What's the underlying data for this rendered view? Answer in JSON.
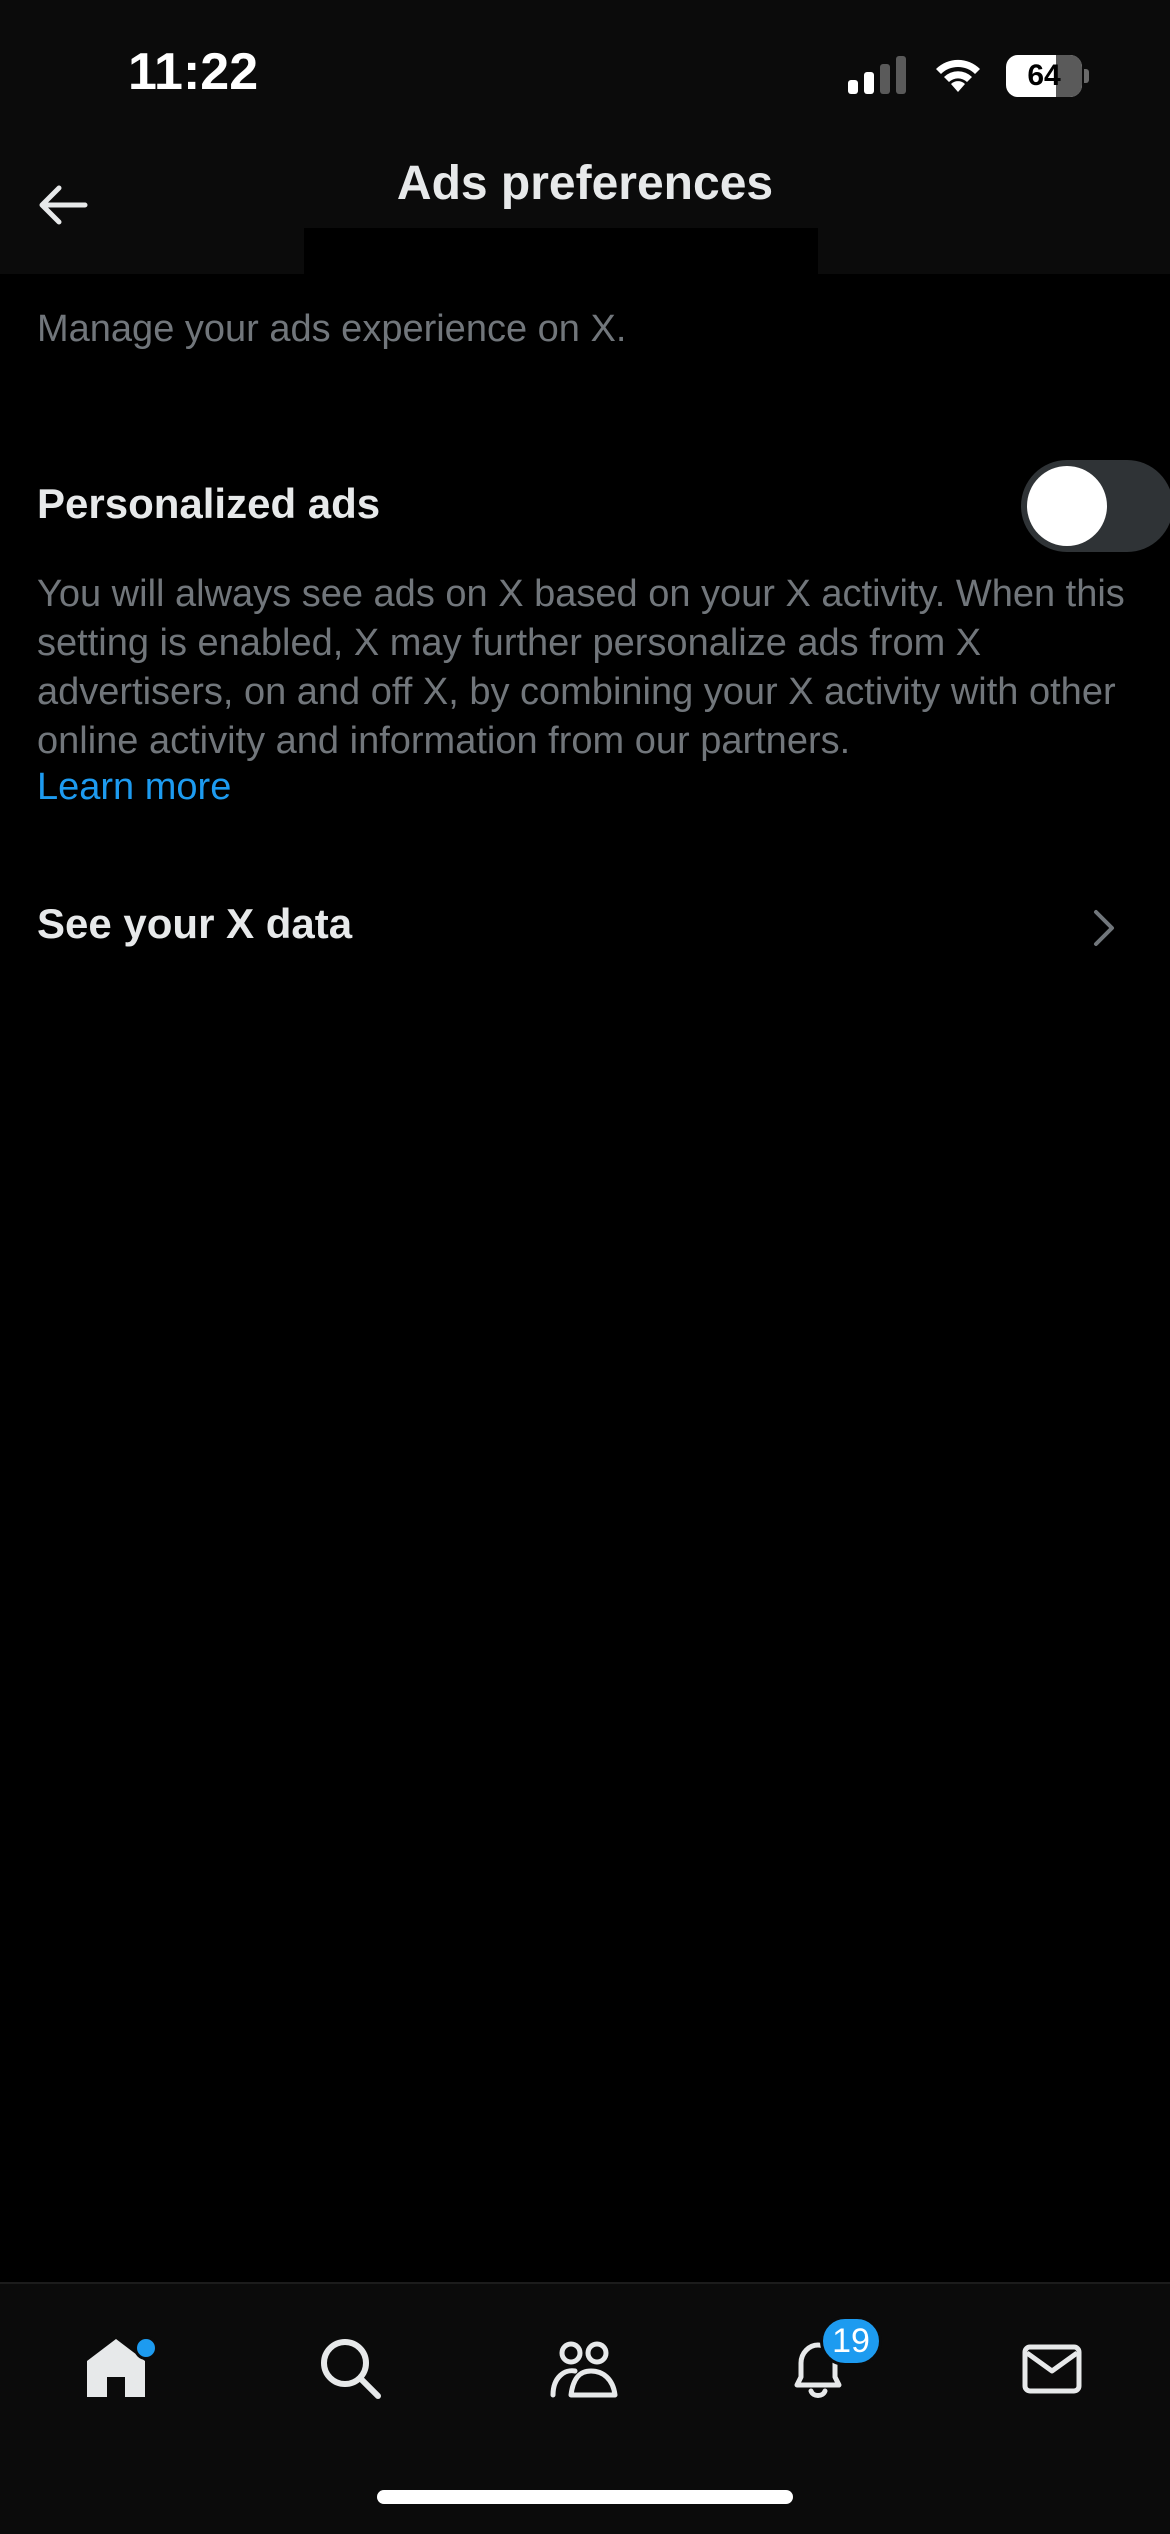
{
  "status_bar": {
    "time": "11:22",
    "battery": "64"
  },
  "header": {
    "title": "Ads preferences",
    "back_icon": "arrow-left-icon"
  },
  "content": {
    "subtitle": "Manage your ads experience on X.",
    "personalized_ads": {
      "label": "Personalized ads",
      "enabled": false,
      "description": "You will always see ads on X based on your X activity. When this setting is enabled, X may further personalize ads from X advertisers, on and off X, by combining your X activity with other online activity and information from our partners.",
      "learn_more": "Learn more"
    },
    "see_data": {
      "label": "See your X data",
      "icon": "chevron-right-icon"
    }
  },
  "tab_bar": {
    "tabs": [
      {
        "name": "home",
        "icon": "home-icon",
        "has_dot": true
      },
      {
        "name": "search",
        "icon": "search-icon"
      },
      {
        "name": "communities",
        "icon": "communities-icon"
      },
      {
        "name": "notifications",
        "icon": "bell-icon",
        "badge": "19"
      },
      {
        "name": "messages",
        "icon": "envelope-icon"
      }
    ]
  },
  "colors": {
    "accent": "#1d9bf0",
    "background": "#000000",
    "secondary_text": "#71767b",
    "primary_text": "#e7e9ea"
  }
}
